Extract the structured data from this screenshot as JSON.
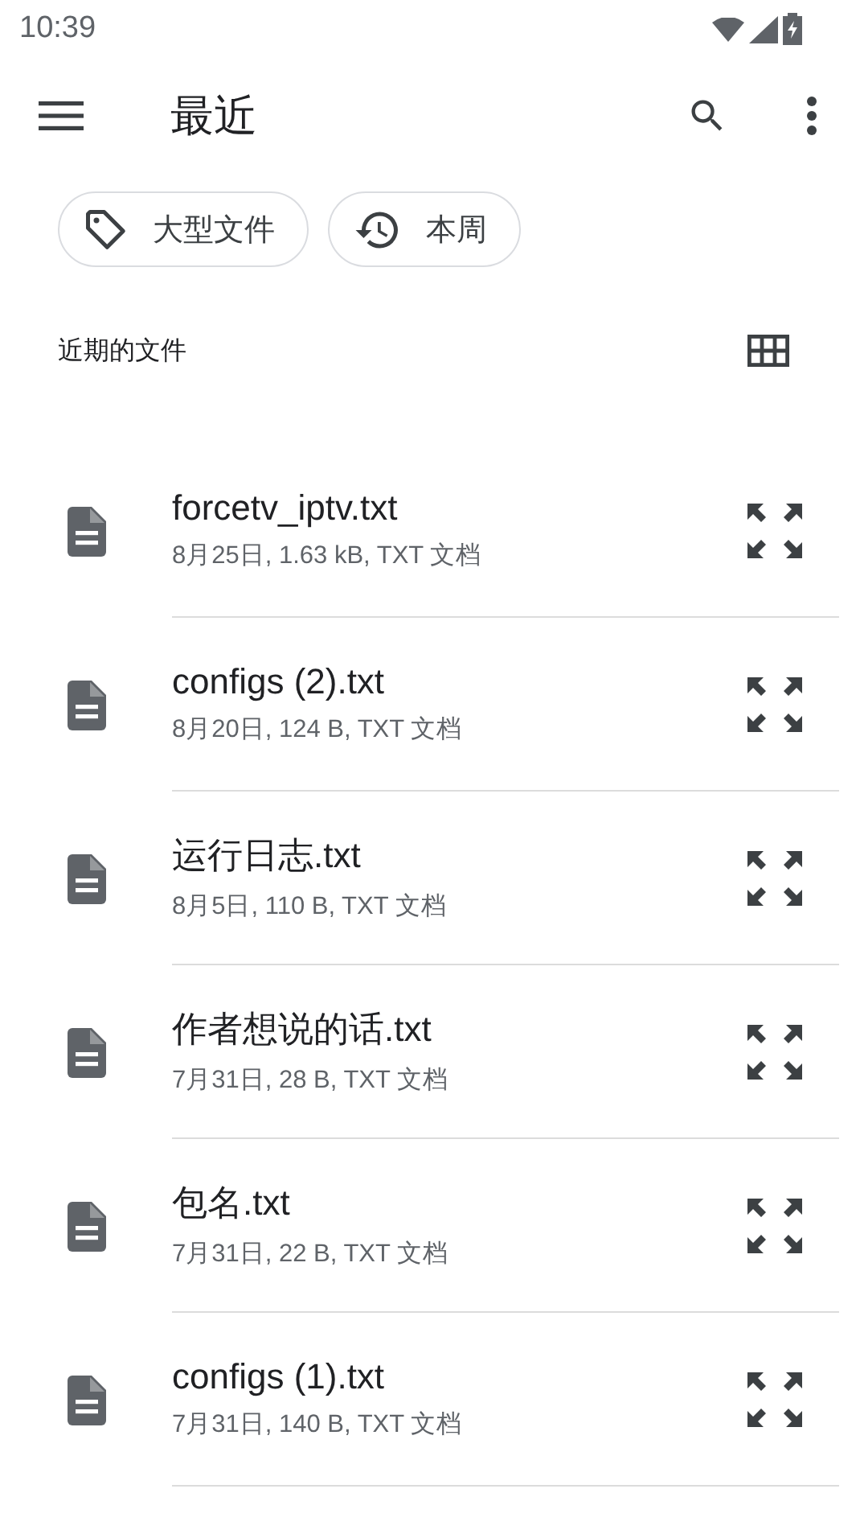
{
  "status_bar": {
    "time": "10:39"
  },
  "app_bar": {
    "title": "最近"
  },
  "chips": [
    {
      "kind": "tag",
      "label": "大型文件"
    },
    {
      "kind": "history",
      "label": "本周"
    }
  ],
  "section": {
    "title": "近期的文件"
  },
  "files": [
    {
      "name": "forcetv_iptv.txt",
      "details": "8月25日, 1.63 kB, TXT 文档"
    },
    {
      "name": "configs (2).txt",
      "details": "8月20日, 124 B, TXT 文档"
    },
    {
      "name": "运行日志.txt",
      "details": "8月5日, 110 B, TXT 文档"
    },
    {
      "name": "作者想说的话.txt",
      "details": "7月31日, 28 B, TXT 文档"
    },
    {
      "name": "包名.txt",
      "details": "7月31日, 22 B, TXT 文档"
    },
    {
      "name": "configs (1).txt",
      "details": "7月31日, 140 B, TXT 文档"
    }
  ]
}
